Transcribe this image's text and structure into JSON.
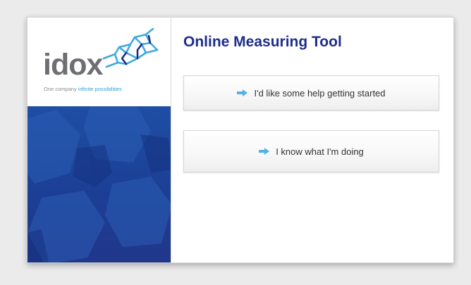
{
  "brand": {
    "logo_word": "idox",
    "tagline_plain": "One company",
    "tagline_accent": "infinite possibilities",
    "primary_color": "#1f2d8a",
    "accent_color": "#2aa1d8",
    "panel_color": "#1f4ea4"
  },
  "dialog": {
    "title": "Online Measuring Tool",
    "options": [
      {
        "label": "I'd like some help getting started",
        "icon": "arrow-right-icon"
      },
      {
        "label": "I know what I'm doing",
        "icon": "arrow-right-icon"
      }
    ]
  }
}
